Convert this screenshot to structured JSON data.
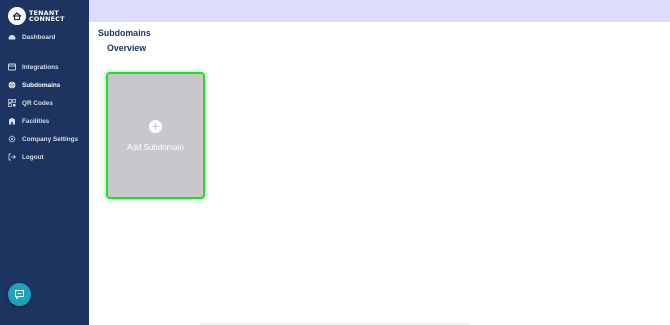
{
  "brand": {
    "line1": "TENANT",
    "line2": "CONNECT"
  },
  "sidebar": {
    "items": [
      {
        "label": "Dashboard",
        "icon": "dashboard-icon"
      },
      {
        "label": "Integrations",
        "icon": "integrations-icon"
      },
      {
        "label": "Subdomains",
        "icon": "globe-icon",
        "active": true
      },
      {
        "label": "QR Codes",
        "icon": "qr-code-icon"
      },
      {
        "label": "Facilities",
        "icon": "building-icon"
      },
      {
        "label": "Company Settings",
        "icon": "gear-icon"
      },
      {
        "label": "Logout",
        "icon": "logout-icon"
      }
    ]
  },
  "header": {
    "title": "Subdomains"
  },
  "main": {
    "section_title": "Overview",
    "add_card_label": "Add Subdomain"
  },
  "colors": {
    "sidebar_bg": "#1d3461",
    "topbar_bg": "#dcdcfc",
    "card_bg": "#c8c8cc",
    "card_highlight": "#22dd22",
    "chat_button": "#1fa3bd"
  }
}
